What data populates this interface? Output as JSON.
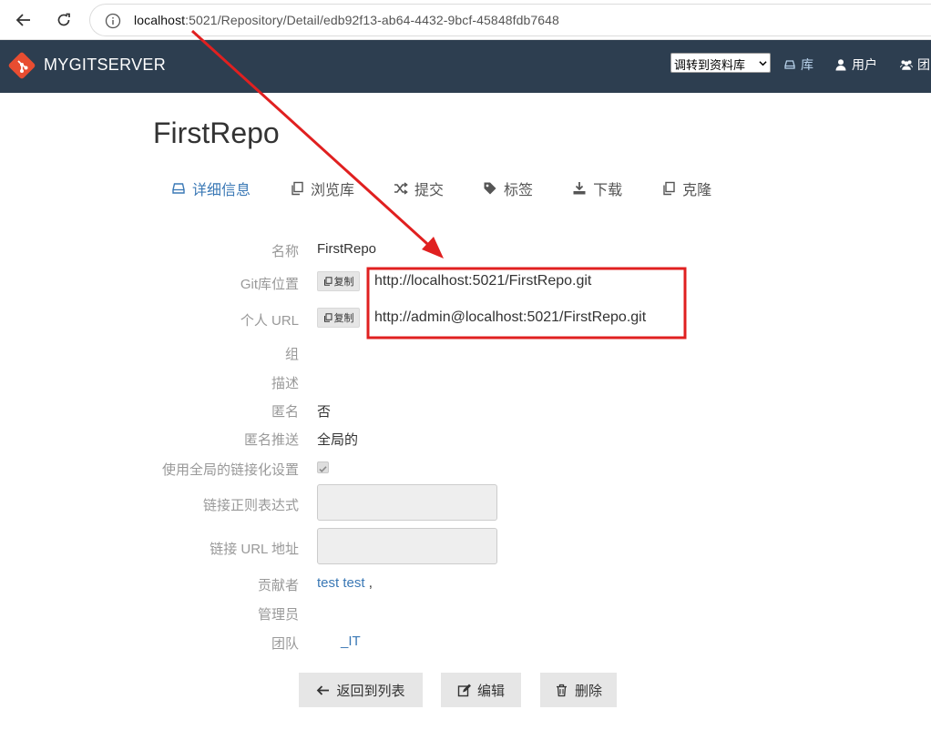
{
  "browser": {
    "url_host": "localhost",
    "url_rest": ":5021/Repository/Detail/edb92f13-ab64-4432-9bcf-45848fdb7648"
  },
  "header": {
    "brand": "MYGITSERVER",
    "jump_select": "调转到资料库",
    "nav": [
      {
        "label": "库",
        "icon": "database-icon"
      },
      {
        "label": "用户",
        "icon": "user-icon"
      },
      {
        "label": "团",
        "icon": "group-icon"
      }
    ]
  },
  "page": {
    "title": "FirstRepo"
  },
  "tabs": [
    {
      "label": "详细信息",
      "icon": "database-icon",
      "active": true
    },
    {
      "label": "浏览库",
      "icon": "copy-icon"
    },
    {
      "label": "提交",
      "icon": "shuffle-icon"
    },
    {
      "label": "标签",
      "icon": "tag-icon"
    },
    {
      "label": "下载",
      "icon": "download-icon"
    },
    {
      "label": "克隆",
      "icon": "clone-icon"
    }
  ],
  "details": {
    "name_label": "名称",
    "name_value": "FirstRepo",
    "git_location_label": "Git库位置",
    "git_location_value": "http://localhost:5021/FirstRepo.git",
    "personal_url_label": "个人 URL",
    "personal_url_value": "http://admin@localhost:5021/FirstRepo.git",
    "copy_label": "复制",
    "group_label": "组",
    "description_label": "描述",
    "anonymous_label": "匿名",
    "anonymous_value": "否",
    "anonymous_push_label": "匿名推送",
    "anonymous_push_value": "全局的",
    "global_link_settings_label": "使用全局的链接化设置",
    "global_link_settings_checked": true,
    "link_regex_label": "链接正则表达式",
    "link_url_label": "链接 URL 地址",
    "contributors_label": "贡献者",
    "contributors_value": "test test",
    "contributors_suffix": ",",
    "admins_label": "管理员",
    "team_label": "团队",
    "team_value": "_IT"
  },
  "buttons": {
    "back": "返回到列表",
    "edit": "编辑",
    "delete": "删除"
  },
  "colors": {
    "header_bg": "#2d3e50",
    "link": "#3a78b5",
    "annotation": "#e02020"
  }
}
